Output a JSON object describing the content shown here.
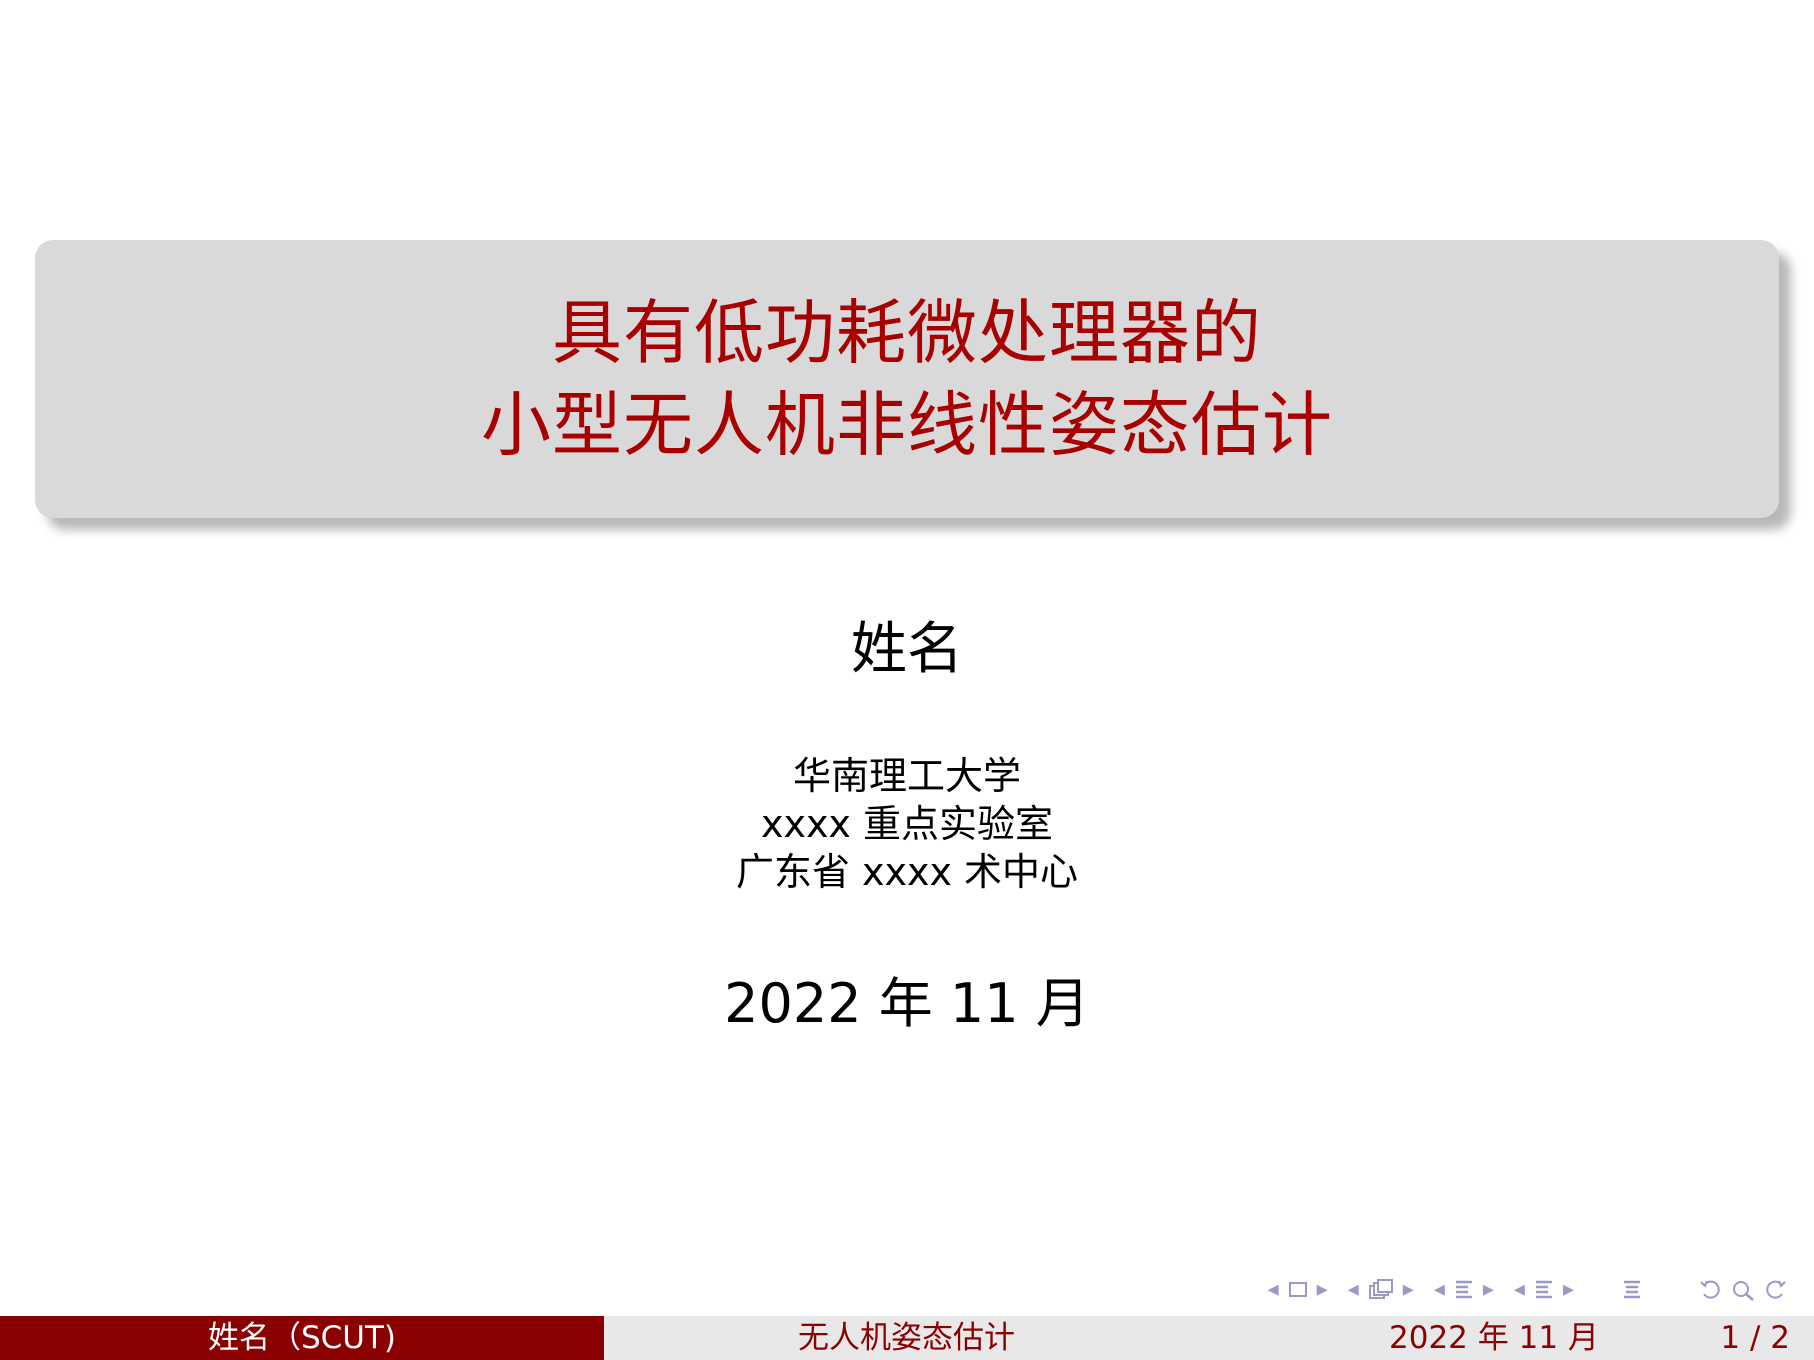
{
  "title": {
    "line1": "具有低功耗微处理器的",
    "line2": "小型无人机非线性姿态估计"
  },
  "author": "姓名",
  "affiliation": {
    "line1": "华南理工大学",
    "line2": "xxxx 重点实验室",
    "line3": "广东省 xxxx 术中心"
  },
  "date": "2022 年 11 月",
  "footer": {
    "author_short": "姓名（SCUT)",
    "short_title": "无人机姿态估计",
    "date": "2022 年 11 月",
    "page": "1 / 2"
  },
  "nav_icons": [
    "frame-nav-icon",
    "subsection-nav-icon",
    "section-nav-icon",
    "document-nav-icon",
    "toc-icon",
    "back-icon",
    "search-icon",
    "forward-icon"
  ],
  "colors": {
    "title_red": "#a80000",
    "footer_dark_red": "#8b0000",
    "footer_gray": "#e8e8e8",
    "title_box_gray": "#d9d9d9",
    "nav_symbol": "#9a9ac8"
  }
}
